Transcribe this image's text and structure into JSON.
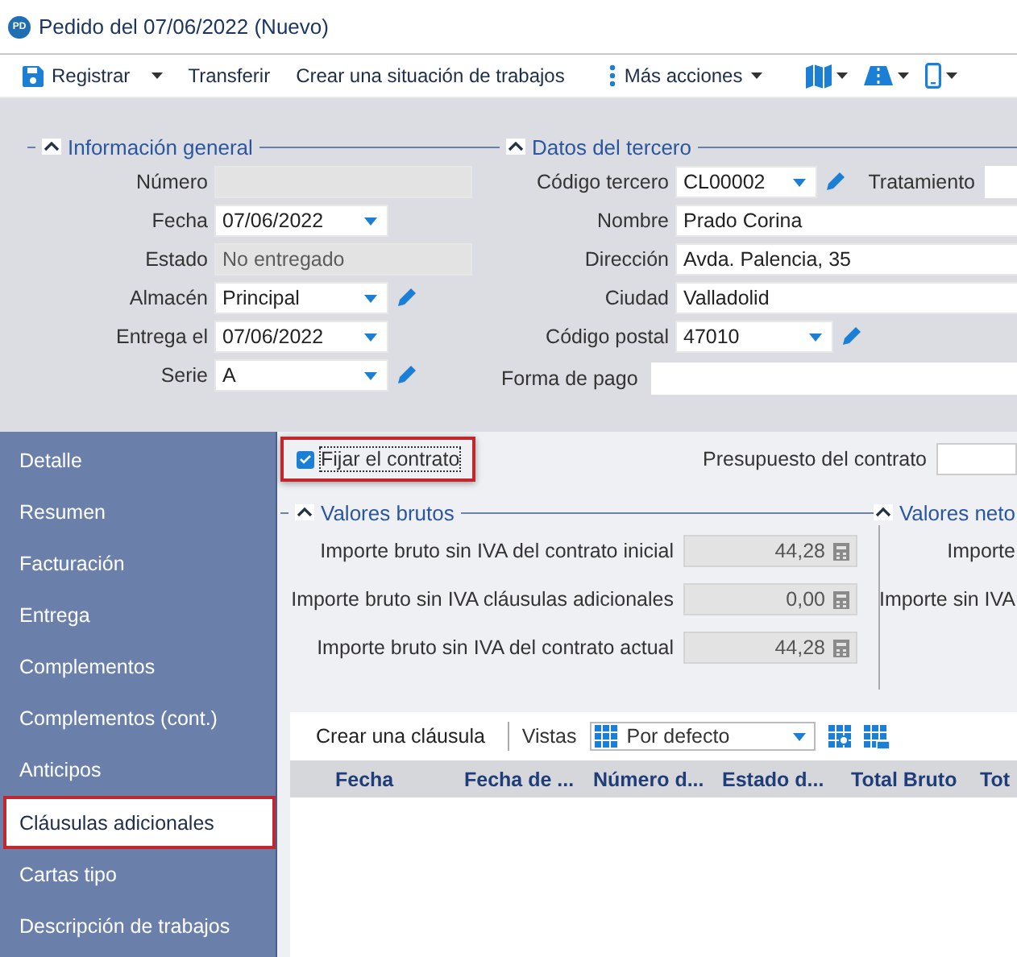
{
  "window": {
    "title": "Pedido del 07/06/2022 (Nuevo)",
    "badge": "PD"
  },
  "toolbar": [
    {
      "kind": "save",
      "label": "Registrar",
      "dropdown": true
    },
    {
      "kind": "plain",
      "label": "Transferir",
      "dropdown": false
    },
    {
      "kind": "plain",
      "label": "Crear una situación de trabajos",
      "dropdown": false
    },
    {
      "kind": "more",
      "label": "Más acciones",
      "dropdown": true
    },
    {
      "kind": "map",
      "dropdown": true
    },
    {
      "kind": "road",
      "dropdown": true
    },
    {
      "kind": "phone",
      "dropdown": true
    }
  ],
  "general_info": {
    "title": "Información general",
    "fields": [
      {
        "label": "Número",
        "kind": "disabled"
      },
      {
        "label": "Fecha",
        "kind": "date",
        "value": "07/06/2022"
      },
      {
        "label": "Estado",
        "kind": "disabled",
        "value": "No entregado"
      },
      {
        "label": "Almacén",
        "kind": "lookup",
        "value": "Principal"
      },
      {
        "label": "Entrega el",
        "kind": "date",
        "value": "07/06/2022"
      },
      {
        "label": "Serie",
        "kind": "lookup",
        "value": "A"
      }
    ]
  },
  "third_party": {
    "title": "Datos del tercero",
    "fields": [
      {
        "label": "Código tercero",
        "kind": "lookup",
        "value": "CL00002"
      },
      {
        "label": "Nombre",
        "kind": "text",
        "value": "Prado Corina"
      },
      {
        "label": "Dirección",
        "kind": "text",
        "value": "Avda. Palencia, 35"
      },
      {
        "label": "Ciudad",
        "kind": "text",
        "value": "Valladolid"
      },
      {
        "label": "Código postal",
        "kind": "lookup",
        "value": "47010"
      }
    ],
    "treatment_label": "Tratamiento",
    "payment_label": "Forma de pago"
  },
  "sidebar": {
    "items": [
      {
        "label": "Detalle",
        "selected": false
      },
      {
        "label": "Resumen",
        "selected": false
      },
      {
        "label": "Facturación",
        "selected": false
      },
      {
        "label": "Entrega",
        "selected": false
      },
      {
        "label": "Complementos",
        "selected": false
      },
      {
        "label": "Complementos (cont.)",
        "selected": false
      },
      {
        "label": "Anticipos",
        "selected": false
      },
      {
        "label": "Cláusulas adicionales",
        "selected": true
      },
      {
        "label": "Cartas tipo",
        "selected": false
      },
      {
        "label": "Descripción de trabajos",
        "selected": false
      }
    ]
  },
  "contract": {
    "fix_label": "Fijar el contrato",
    "checked": true,
    "highlighted": true,
    "budget_label": "Presupuesto del contrato"
  },
  "gross_values": {
    "title": "Valores brutos",
    "rows": [
      {
        "label": "Importe bruto sin IVA del contrato inicial",
        "value": "44,28"
      },
      {
        "label": "Importe bruto sin IVA cláusulas adicionales",
        "value": "0,00"
      },
      {
        "label": "Importe bruto sin IVA del contrato actual",
        "value": "44,28"
      }
    ]
  },
  "net_values": {
    "title": "Valores neto",
    "rows": [
      "Importe",
      "Importe sin IVA"
    ]
  },
  "clauses": {
    "create_label": "Crear una cláusula",
    "views_label": "Vistas",
    "view_value": "Por defecto",
    "columns": [
      "Fecha",
      "Fecha de ...",
      "Número d...",
      "Estado d...",
      "Total Bruto",
      "Tot"
    ]
  }
}
